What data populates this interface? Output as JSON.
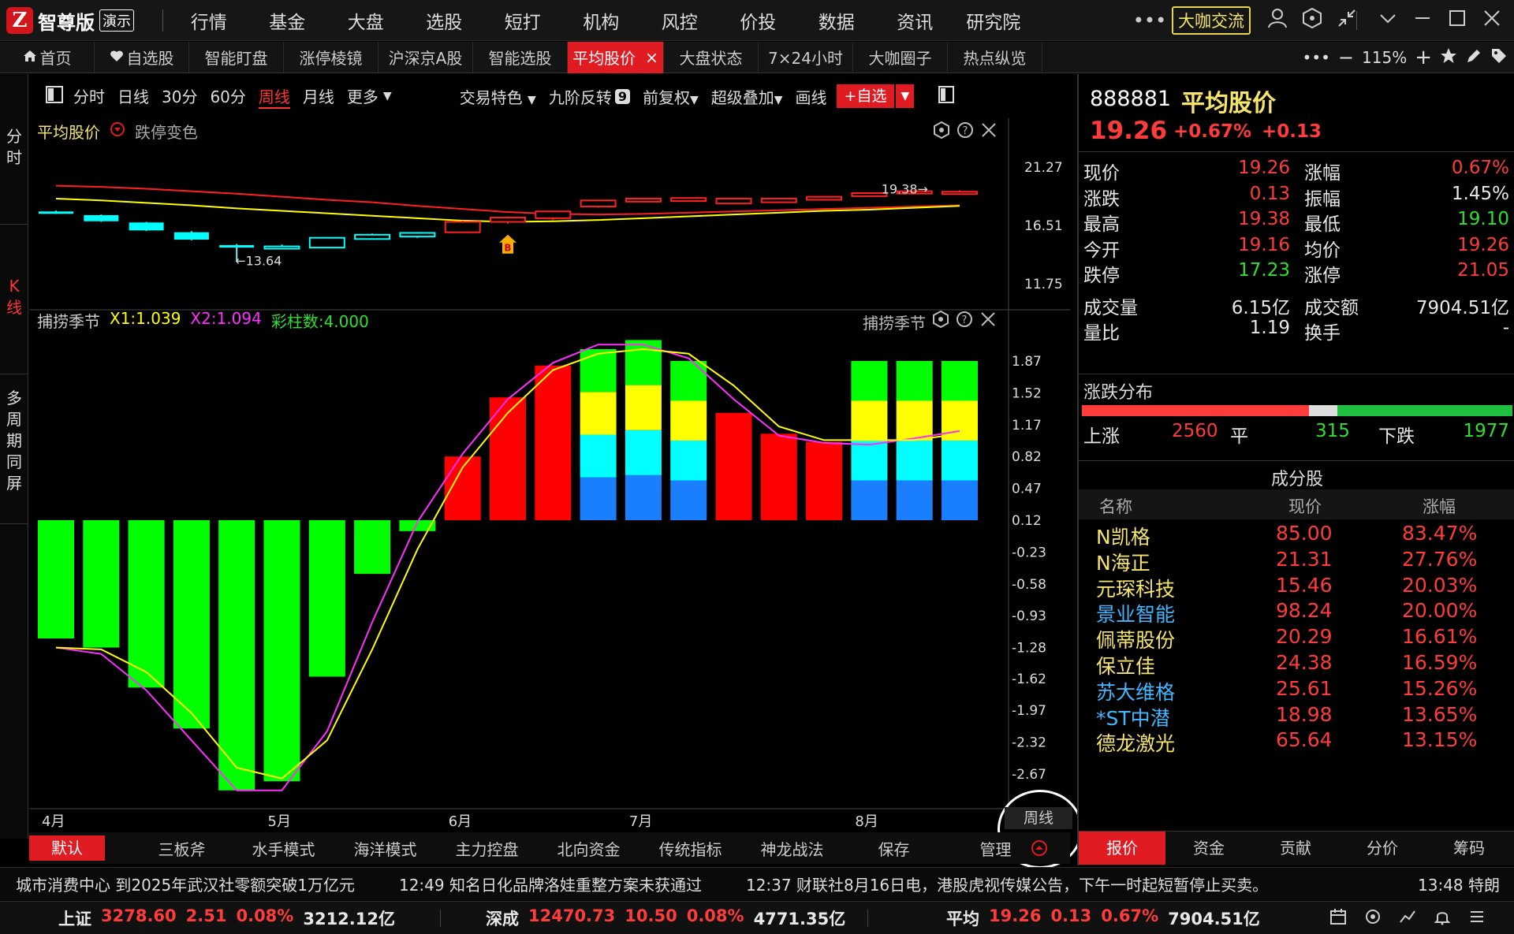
{
  "app": {
    "logo_mark": "Z",
    "name": "智尊版",
    "badge": "演示"
  },
  "menu": [
    "行情",
    "基金",
    "大盘",
    "选股",
    "短打",
    "机构",
    "风控",
    "价投",
    "数据",
    "资讯",
    "研究院"
  ],
  "titlebar": {
    "more": "•••",
    "daka": "大咖交流"
  },
  "tabs": [
    {
      "label": "首页",
      "icon": "home-icon"
    },
    {
      "label": "自选股",
      "icon": "heart-icon"
    },
    {
      "label": "智能盯盘"
    },
    {
      "label": "涨停棱镜"
    },
    {
      "label": "沪深京A股"
    },
    {
      "label": "智能选股"
    },
    {
      "label": "平均股价",
      "active": true
    },
    {
      "label": "大盘状态"
    },
    {
      "label": "7×24小时"
    },
    {
      "label": "大咖圈子"
    },
    {
      "label": "热点纵览"
    }
  ],
  "tab_close": "×",
  "tabbar_right": {
    "more": "•••",
    "minus": "−",
    "zoom": "115%",
    "plus": "+"
  },
  "left_strip": {
    "fenshi": [
      "分",
      "时"
    ],
    "kline": [
      "K",
      "线"
    ],
    "multi": [
      "多",
      "周",
      "期",
      "同",
      "屏"
    ]
  },
  "chart_toolbar": {
    "periods": [
      "分时",
      "日线",
      "30分",
      "60分",
      "周线",
      "月线",
      "更多"
    ],
    "active": "周线",
    "tools": [
      "交易特色",
      "九阶反转",
      "前复权",
      "超级叠加",
      "画线"
    ],
    "nine_badge": "9",
    "add_button": "+自选"
  },
  "main_panel": {
    "name": "平均股价",
    "option": "跌停变色",
    "high_label": "19.38→",
    "low_label": "←13.64",
    "signal": "B",
    "y_ticks": [
      "21.27",
      "16.51",
      "11.75"
    ]
  },
  "indicator_panel": {
    "name": "捕捞季节",
    "x1": "X1:1.039",
    "x2": "X2:1.094",
    "cz": "彩柱数:4.000",
    "name_right": "捕捞季节",
    "y_ticks": [
      "1.87",
      "1.52",
      "1.17",
      "0.82",
      "0.47",
      "0.12",
      "-0.23",
      "-0.58",
      "-0.93",
      "-1.28",
      "-1.62",
      "-1.97",
      "-2.32",
      "-2.67"
    ]
  },
  "x_months": [
    "4月",
    "5月",
    "6月",
    "7月",
    "8月"
  ],
  "period_label": "周线",
  "chart_data": {
    "type": "candlestick+bar",
    "price": {
      "ylim": [
        11.75,
        21.27
      ],
      "candles": [
        {
          "o": 17.65,
          "c": 17.55,
          "h": 17.72,
          "l": 17.45
        },
        {
          "o": 17.35,
          "c": 16.85,
          "h": 17.4,
          "l": 16.8
        },
        {
          "o": 16.75,
          "c": 16.1,
          "h": 16.8,
          "l": 16.05
        },
        {
          "o": 15.95,
          "c": 15.35,
          "h": 16.05,
          "l": 15.3
        },
        {
          "o": 14.9,
          "c": 14.7,
          "h": 15.0,
          "l": 13.64
        },
        {
          "o": 14.7,
          "c": 14.8,
          "h": 14.95,
          "l": 14.6
        },
        {
          "o": 14.7,
          "c": 15.5,
          "h": 15.55,
          "l": 14.65
        },
        {
          "o": 15.4,
          "c": 15.75,
          "h": 15.85,
          "l": 15.35
        },
        {
          "o": 15.6,
          "c": 15.9,
          "h": 15.95,
          "l": 15.5
        },
        {
          "o": 15.95,
          "c": 16.8,
          "h": 16.9,
          "l": 15.9
        },
        {
          "o": 16.8,
          "c": 17.15,
          "h": 17.25,
          "l": 16.65
        },
        {
          "o": 17.1,
          "c": 17.65,
          "h": 17.7,
          "l": 16.95
        },
        {
          "o": 18.05,
          "c": 18.55,
          "h": 18.6,
          "l": 17.95
        },
        {
          "o": 18.45,
          "c": 18.7,
          "h": 18.75,
          "l": 18.4
        },
        {
          "o": 18.5,
          "c": 18.75,
          "h": 18.8,
          "l": 18.45
        },
        {
          "o": 18.3,
          "c": 18.7,
          "h": 18.75,
          "l": 18.25
        },
        {
          "o": 18.4,
          "c": 18.7,
          "h": 18.75,
          "l": 18.35
        },
        {
          "o": 18.6,
          "c": 18.85,
          "h": 18.9,
          "l": 18.55
        },
        {
          "o": 18.9,
          "c": 19.15,
          "h": 19.2,
          "l": 18.85
        },
        {
          "o": 19.2,
          "c": 19.3,
          "h": 19.38,
          "l": 19.05
        },
        {
          "o": 19.16,
          "c": 19.26,
          "h": 19.38,
          "l": 19.1
        }
      ],
      "ma1": [
        19.75,
        19.65,
        19.5,
        19.3,
        19.1,
        18.85,
        18.6,
        18.4,
        18.1,
        17.85,
        17.6,
        17.45,
        17.4,
        17.45,
        17.55,
        17.65,
        17.75,
        17.85,
        17.95,
        18.05,
        18.15
      ],
      "ma2": [
        18.7,
        18.55,
        18.35,
        18.15,
        17.9,
        17.7,
        17.5,
        17.3,
        17.1,
        16.9,
        16.8,
        16.85,
        16.95,
        17.1,
        17.25,
        17.4,
        17.55,
        17.7,
        17.8,
        17.95,
        18.1
      ]
    },
    "indicator": {
      "ylim": [
        -2.85,
        2.1
      ],
      "zero": 0.12,
      "bars": [
        -1.18,
        -1.28,
        -1.72,
        -2.17,
        -2.85,
        -2.75,
        -1.6,
        -0.47,
        0.0,
        0.82,
        1.47,
        1.82,
        2.0,
        2.1,
        1.87,
        1.3,
        1.07,
        0.98,
        1.87,
        1.87,
        1.87
      ],
      "colored": [
        false,
        false,
        false,
        false,
        false,
        false,
        false,
        false,
        false,
        false,
        false,
        false,
        true,
        true,
        true,
        false,
        false,
        false,
        true,
        true,
        true
      ],
      "x1": [
        -1.28,
        -1.3,
        -1.55,
        -2.0,
        -2.6,
        -2.72,
        -2.3,
        -1.3,
        -0.2,
        0.7,
        1.3,
        1.77,
        1.95,
        2.0,
        1.95,
        1.6,
        1.15,
        1.0,
        1.0,
        1.0,
        1.07
      ],
      "x2": [
        -1.28,
        -1.35,
        -1.75,
        -2.3,
        -2.85,
        -2.85,
        -2.2,
        -1.0,
        0.1,
        0.85,
        1.45,
        1.85,
        2.05,
        2.05,
        1.9,
        1.45,
        1.05,
        0.97,
        0.95,
        1.02,
        1.1
      ]
    },
    "month_index": [
      0,
      5,
      9,
      13,
      18
    ]
  },
  "bottom_tabs": [
    "默认",
    "三板斧",
    "水手模式",
    "海洋模式",
    "主力控盘",
    "北向资金",
    "传统指标",
    "神龙战法",
    "保存",
    "管理"
  ],
  "stock": {
    "code": "888881",
    "name": "平均股价",
    "price": "19.26",
    "pct": "+0.67%",
    "chg": "+0.13"
  },
  "quote": [
    {
      "l1": "现价",
      "v1": "19.26",
      "c1": "red",
      "l2": "涨幅",
      "v2": "0.67%",
      "c2": "red"
    },
    {
      "l1": "涨跌",
      "v1": "0.13",
      "c1": "red",
      "l2": "振幅",
      "v2": "1.45%",
      "c2": "white"
    },
    {
      "l1": "最高",
      "v1": "19.38",
      "c1": "red",
      "l2": "最低",
      "v2": "19.10",
      "c2": "green"
    },
    {
      "l1": "今开",
      "v1": "19.16",
      "c1": "red",
      "l2": "均价",
      "v2": "19.26",
      "c2": "red"
    },
    {
      "l1": "跌停",
      "v1": "17.23",
      "c1": "green",
      "l2": "涨停",
      "v2": "21.05",
      "c2": "red"
    },
    {
      "l1": "成交量",
      "v1": "6.15亿",
      "c1": "white",
      "l2": "成交额",
      "v2": "7904.51亿",
      "c2": "white"
    },
    {
      "l1": "量比",
      "v1": "1.19",
      "c1": "white",
      "l2": "换手",
      "v2": "-",
      "c2": "white"
    }
  ],
  "distribution": {
    "title": "涨跌分布",
    "up_label": "上涨",
    "up": "2560",
    "flat_label": "平",
    "flat": "315",
    "down_label": "下跌",
    "down": "1977",
    "up_n": 2560,
    "flat_n": 315,
    "down_n": 1977
  },
  "components": {
    "title": "成分股",
    "headers": [
      "名称",
      "现价",
      "涨幅"
    ],
    "rows": [
      {
        "name": "N凯格",
        "price": "85.00",
        "pct": "83.47%",
        "nc": "yellow"
      },
      {
        "name": "N海正",
        "price": "21.31",
        "pct": "27.76%",
        "nc": "yellow"
      },
      {
        "name": "元琛科技",
        "price": "15.46",
        "pct": "20.03%",
        "nc": "yellow"
      },
      {
        "name": "景业智能",
        "price": "98.24",
        "pct": "20.00%",
        "nc": "blue"
      },
      {
        "name": "佩蒂股份",
        "price": "20.29",
        "pct": "16.61%",
        "nc": "yellow"
      },
      {
        "name": "保立佳",
        "price": "24.38",
        "pct": "16.59%",
        "nc": "yellow"
      },
      {
        "name": "苏大维格",
        "price": "25.61",
        "pct": "15.26%",
        "nc": "blue"
      },
      {
        "name": "*ST中潜",
        "price": "18.98",
        "pct": "13.65%",
        "nc": "blue"
      },
      {
        "name": "德龙激光",
        "price": "65.64",
        "pct": "13.15%",
        "nc": "yellow"
      }
    ]
  },
  "right_tabs": [
    "报价",
    "资金",
    "贡献",
    "分价",
    "筹码"
  ],
  "news": [
    "城市消费中心 到2025年武汉社零额突破1万亿元",
    "12:49 知名日化品牌洛娃重整方案未获通过",
    "12:37 财联社8月16日电，港股虎视传媒公告，下午一时起短暂停止买卖。"
  ],
  "news_time": "13:48 特朗",
  "indices": [
    {
      "name": "上证",
      "price": "3278.60",
      "chg": "2.51",
      "pct": "0.08%",
      "amt": "3212.12亿"
    },
    {
      "name": "深成",
      "price": "12470.73",
      "chg": "10.50",
      "pct": "0.08%",
      "amt": "4771.35亿"
    },
    {
      "name": "平均",
      "price": "19.26",
      "chg": "0.13",
      "pct": "0.67%",
      "amt": "7904.51亿"
    }
  ],
  "colors": {
    "up": "#ff2020",
    "down": "#2fe02f",
    "cyan": "#00ffff",
    "yellow": "#ffff00",
    "magenta": "#ff30ff",
    "blue": "#1a7fff",
    "accent": "#e11b22"
  }
}
